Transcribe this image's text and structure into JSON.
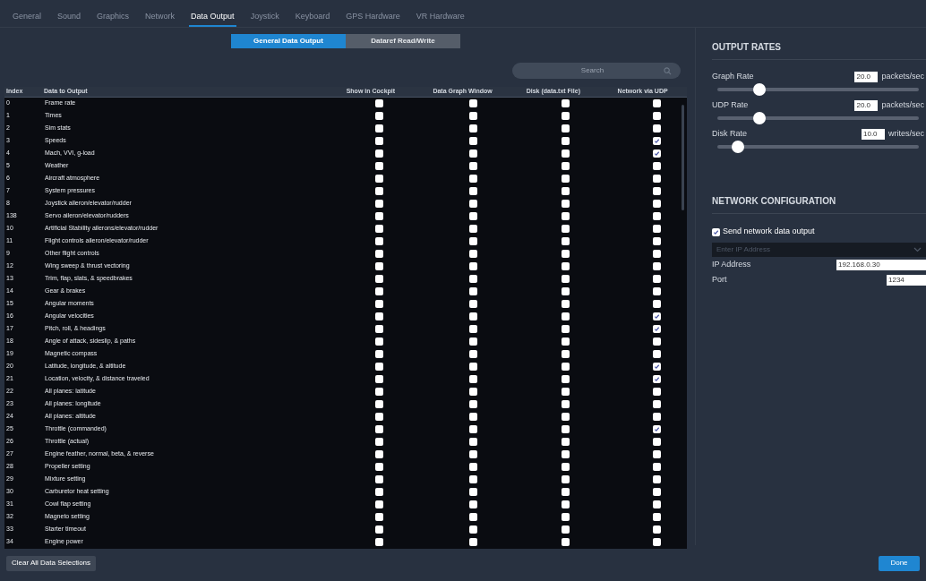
{
  "tabs": [
    {
      "label": "General",
      "selected": false
    },
    {
      "label": "Sound",
      "selected": false
    },
    {
      "label": "Graphics",
      "selected": false
    },
    {
      "label": "Network",
      "selected": false
    },
    {
      "label": "Data Output",
      "selected": true
    },
    {
      "label": "Joystick",
      "selected": false
    },
    {
      "label": "Keyboard",
      "selected": false
    },
    {
      "label": "GPS Hardware",
      "selected": false
    },
    {
      "label": "VR Hardware",
      "selected": false
    }
  ],
  "modes": [
    {
      "label": "General Data Output",
      "selected": true
    },
    {
      "label": "Dataref Read/Write",
      "selected": false
    }
  ],
  "search": {
    "placeholder": "Search"
  },
  "table": {
    "columns": [
      "Index",
      "Data to Output",
      "Show in Cockpit",
      "Data Graph Window",
      "Disk (data.txt File)",
      "Network via UDP"
    ],
    "rows": [
      {
        "index": "0",
        "name": "Frame rate",
        "cockpit": false,
        "graph": false,
        "disk": false,
        "udp": false
      },
      {
        "index": "1",
        "name": "Times",
        "cockpit": false,
        "graph": false,
        "disk": false,
        "udp": false
      },
      {
        "index": "2",
        "name": "Sim stats",
        "cockpit": false,
        "graph": false,
        "disk": false,
        "udp": false
      },
      {
        "index": "3",
        "name": "Speeds",
        "cockpit": false,
        "graph": false,
        "disk": false,
        "udp": true
      },
      {
        "index": "4",
        "name": "Mach, VVI, g-load",
        "cockpit": false,
        "graph": false,
        "disk": false,
        "udp": true
      },
      {
        "index": "5",
        "name": "Weather",
        "cockpit": false,
        "graph": false,
        "disk": false,
        "udp": false
      },
      {
        "index": "6",
        "name": "Aircraft atmosphere",
        "cockpit": false,
        "graph": false,
        "disk": false,
        "udp": false
      },
      {
        "index": "7",
        "name": "System pressures",
        "cockpit": false,
        "graph": false,
        "disk": false,
        "udp": false
      },
      {
        "index": "8",
        "name": "Joystick aileron/elevator/rudder",
        "cockpit": false,
        "graph": false,
        "disk": false,
        "udp": false
      },
      {
        "index": "138",
        "name": "Servo aileron/elevator/rudders",
        "cockpit": false,
        "graph": false,
        "disk": false,
        "udp": false
      },
      {
        "index": "10",
        "name": "Artificial Stability ailerons/elevator/rudder",
        "cockpit": false,
        "graph": false,
        "disk": false,
        "udp": false
      },
      {
        "index": "11",
        "name": "Flight controls aileron/elevator/rudder",
        "cockpit": false,
        "graph": false,
        "disk": false,
        "udp": false
      },
      {
        "index": "9",
        "name": "Other flight controls",
        "cockpit": false,
        "graph": false,
        "disk": false,
        "udp": false
      },
      {
        "index": "12",
        "name": "Wing sweep & thrust vectoring",
        "cockpit": false,
        "graph": false,
        "disk": false,
        "udp": false
      },
      {
        "index": "13",
        "name": "Trim, flap, slats, & speedbrakes",
        "cockpit": false,
        "graph": false,
        "disk": false,
        "udp": false
      },
      {
        "index": "14",
        "name": "Gear & brakes",
        "cockpit": false,
        "graph": false,
        "disk": false,
        "udp": false
      },
      {
        "index": "15",
        "name": "Angular moments",
        "cockpit": false,
        "graph": false,
        "disk": false,
        "udp": false
      },
      {
        "index": "16",
        "name": "Angular velocities",
        "cockpit": false,
        "graph": false,
        "disk": false,
        "udp": true
      },
      {
        "index": "17",
        "name": "Pitch, roll, & headings",
        "cockpit": false,
        "graph": false,
        "disk": false,
        "udp": true
      },
      {
        "index": "18",
        "name": "Angle of attack, sideslip, & paths",
        "cockpit": false,
        "graph": false,
        "disk": false,
        "udp": false
      },
      {
        "index": "19",
        "name": "Magnetic compass",
        "cockpit": false,
        "graph": false,
        "disk": false,
        "udp": false
      },
      {
        "index": "20",
        "name": "Latitude, longitude, & altitude",
        "cockpit": false,
        "graph": false,
        "disk": false,
        "udp": true
      },
      {
        "index": "21",
        "name": "Location, velocity, & distance traveled",
        "cockpit": false,
        "graph": false,
        "disk": false,
        "udp": true
      },
      {
        "index": "22",
        "name": "All planes: latitude",
        "cockpit": false,
        "graph": false,
        "disk": false,
        "udp": false
      },
      {
        "index": "23",
        "name": "All planes: longitude",
        "cockpit": false,
        "graph": false,
        "disk": false,
        "udp": false
      },
      {
        "index": "24",
        "name": "All planes: altitude",
        "cockpit": false,
        "graph": false,
        "disk": false,
        "udp": false
      },
      {
        "index": "25",
        "name": "Throttle (commanded)",
        "cockpit": false,
        "graph": false,
        "disk": false,
        "udp": true
      },
      {
        "index": "26",
        "name": "Throttle (actual)",
        "cockpit": false,
        "graph": false,
        "disk": false,
        "udp": false
      },
      {
        "index": "27",
        "name": "Engine feather, normal, beta, & reverse",
        "cockpit": false,
        "graph": false,
        "disk": false,
        "udp": false
      },
      {
        "index": "28",
        "name": "Propeller setting",
        "cockpit": false,
        "graph": false,
        "disk": false,
        "udp": false
      },
      {
        "index": "29",
        "name": "Mixture setting",
        "cockpit": false,
        "graph": false,
        "disk": false,
        "udp": false
      },
      {
        "index": "30",
        "name": "Carburetor heat setting",
        "cockpit": false,
        "graph": false,
        "disk": false,
        "udp": false
      },
      {
        "index": "31",
        "name": "Cowl flap setting",
        "cockpit": false,
        "graph": false,
        "disk": false,
        "udp": false
      },
      {
        "index": "32",
        "name": "Magneto setting",
        "cockpit": false,
        "graph": false,
        "disk": false,
        "udp": false
      },
      {
        "index": "33",
        "name": "Starter timeout",
        "cockpit": false,
        "graph": false,
        "disk": false,
        "udp": false
      },
      {
        "index": "34",
        "name": "Engine power",
        "cockpit": false,
        "graph": false,
        "disk": false,
        "udp": false
      }
    ]
  },
  "output_rates": {
    "title": "OUTPUT RATES",
    "rates": [
      {
        "label": "Graph Rate",
        "value": "20.0",
        "unit": "packets/sec",
        "level": 0.21
      },
      {
        "label": "UDP Rate",
        "value": "20.0",
        "unit": "packets/sec",
        "level": 0.21
      },
      {
        "label": "Disk Rate",
        "value": "10.0",
        "unit": "writes/sec",
        "level": 0.1
      }
    ]
  },
  "network": {
    "title": "NETWORK CONFIGURATION",
    "send_output": {
      "label": "Send network data output",
      "checked": true
    },
    "address_select": {
      "placeholder": "Enter IP Address"
    },
    "fields": [
      {
        "label": "IP Address",
        "value": "192.168.0.30"
      },
      {
        "label": "Port",
        "value": "1234"
      }
    ]
  },
  "buttons": {
    "clear": "Clear All Data Selections",
    "done": "Done"
  }
}
